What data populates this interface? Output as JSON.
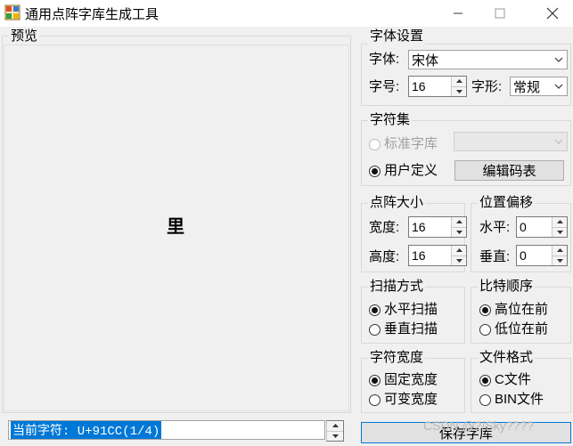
{
  "window": {
    "title": "通用点阵字库生成工具",
    "icon": "app-icon"
  },
  "preview": {
    "legend": "预览",
    "glyph": "里"
  },
  "status": {
    "current_char": "当前字符: U+91CC(1/4)"
  },
  "font_settings": {
    "legend": "字体设置",
    "font_label": "字体:",
    "font_value": "宋体",
    "size_label": "字号:",
    "size_value": "16",
    "style_label": "字形:",
    "style_value": "常规"
  },
  "charset": {
    "legend": "字符集",
    "standard_label": "标准字库",
    "standard_selected": false,
    "custom_label": "用户定义",
    "custom_selected": true,
    "edit_button": "编辑码表"
  },
  "matrix_size": {
    "legend": "点阵大小",
    "width_label": "宽度:",
    "width_value": "16",
    "height_label": "高度:",
    "height_value": "16"
  },
  "offset": {
    "legend": "位置偏移",
    "horizontal_label": "水平:",
    "horizontal_value": "0",
    "vertical_label": "垂直:",
    "vertical_value": "0"
  },
  "scan_mode": {
    "legend": "扫描方式",
    "horizontal_label": "水平扫描",
    "horizontal_selected": true,
    "vertical_label": "垂直扫描",
    "vertical_selected": false
  },
  "bit_order": {
    "legend": "比特顺序",
    "msb_label": "高位在前",
    "msb_selected": true,
    "lsb_label": "低位在前",
    "lsb_selected": false
  },
  "char_width": {
    "legend": "字符宽度",
    "fixed_label": "固定宽度",
    "fixed_selected": true,
    "variable_label": "可变宽度",
    "variable_selected": false
  },
  "file_format": {
    "legend": "文件格式",
    "c_label": "C文件",
    "c_selected": true,
    "bin_label": "BIN文件",
    "bin_selected": false
  },
  "actions": {
    "save_button": "保存字库"
  },
  "watermark": "CSDN @2/Sky????"
}
